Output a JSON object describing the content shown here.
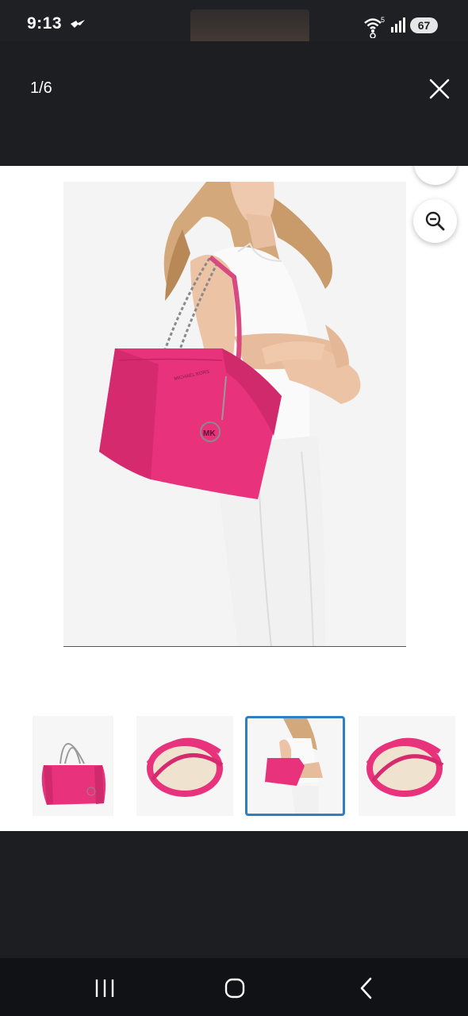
{
  "status_bar": {
    "time": "9:13",
    "network": "5",
    "battery": "67"
  },
  "viewer": {
    "counter": "1/6",
    "close_icon": "close-icon",
    "zoom_icon": "zoom-out-icon"
  },
  "product": {
    "bag_color": "#e8327c",
    "bag_brand_logo": "MK"
  },
  "thumbnails": [
    {
      "name": "bag-front",
      "selected": false
    },
    {
      "name": "bag-interior",
      "selected": false
    },
    {
      "name": "bag-on-model",
      "selected": true
    },
    {
      "name": "bag-interior-2",
      "selected": false
    }
  ],
  "colors": {
    "background_dark": "#1c1e22",
    "selected_border": "#2f7fc1"
  },
  "nav": {
    "recent_icon": "recent-apps-icon",
    "home_icon": "home-icon",
    "back_icon": "back-icon"
  }
}
